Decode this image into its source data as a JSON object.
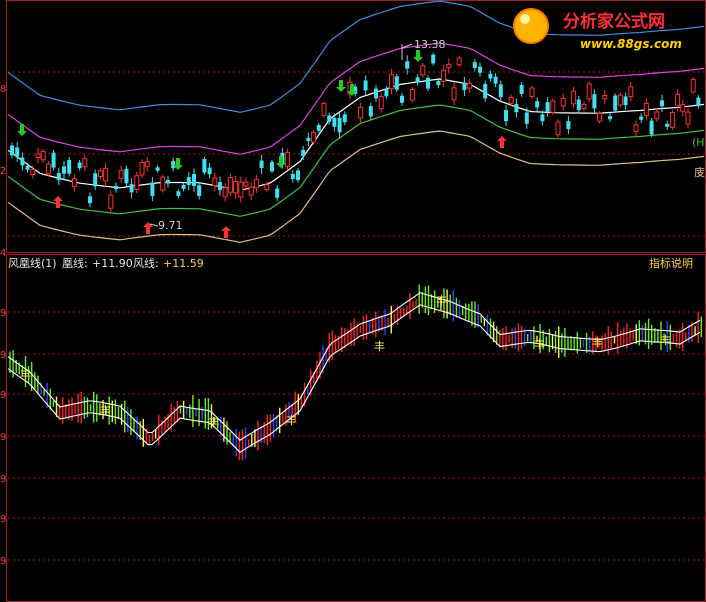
{
  "watermark": {
    "title": "分析家公式网",
    "url": "www.88gs.com"
  },
  "colors": {
    "up": "#ff3030",
    "down": "#40e0f0",
    "band_outer_top": "#3a8fe0",
    "band_upper": "#e040e0",
    "band_mid": "#ffffff",
    "band_lower": "#40c040",
    "band_outer_bottom": "#e0c080",
    "grid": "#b01010",
    "annot": "#cfcfcf",
    "arrow_down": "#22cc22",
    "arrow_up": "#ff3030",
    "osc_red": "#ff2020",
    "osc_green": "#66ee22",
    "osc_blue": "#3344ff",
    "osc_yellow": "#ffee55",
    "osc_line": "#ffffff",
    "header_gold": "#ffd24a",
    "header_white": "#e6e6e6"
  },
  "top_panel": {
    "annotations": {
      "high_label": "13.38",
      "low_label": "9.71"
    },
    "right_markers": [
      "",
      "",
      "",
      "",
      "",
      "(H",
      "庋"
    ],
    "left_ticks": [
      "8",
      "2",
      "4"
    ]
  },
  "bottom_panel": {
    "header": {
      "name": "风凰线(1)",
      "l1_label": "凰线:",
      "l1_value": "+11.90",
      "l2_label": "风线:",
      "l2_value": "+11.59"
    },
    "help_label": "指标说明",
    "left_ticks": [
      "9",
      "9",
      "9",
      "9",
      "9",
      "9",
      "9"
    ],
    "marker_glyph": "丰"
  },
  "chart_data": {
    "type": "candlestick",
    "panels": [
      {
        "name": "price",
        "series": [
          {
            "key": "outer_top",
            "shape": "wave"
          },
          {
            "key": "upper",
            "shape": "wave"
          },
          {
            "key": "mid",
            "shape": "wave"
          },
          {
            "key": "lower",
            "shape": "wave"
          },
          {
            "key": "outer_bottom",
            "shape": "wave"
          }
        ],
        "annotations": [
          {
            "text": "13.38",
            "type": "high"
          },
          {
            "text": "9.71",
            "type": "low"
          }
        ]
      },
      {
        "name": "oscillator",
        "series": [
          {
            "name": "凰线",
            "last": 11.9
          },
          {
            "name": "风线",
            "last": 11.59
          }
        ]
      }
    ]
  }
}
